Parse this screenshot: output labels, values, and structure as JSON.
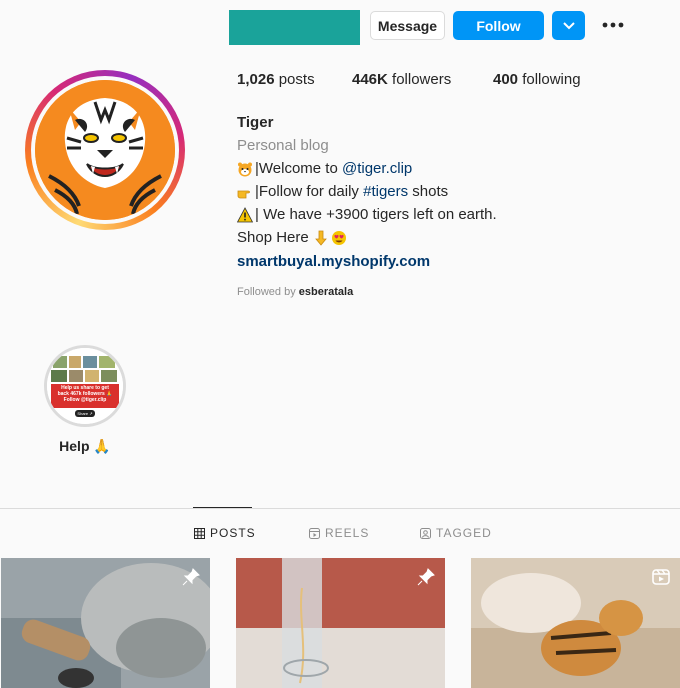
{
  "header": {
    "message_label": "Message",
    "follow_label": "Follow",
    "dropdown_icon": "chevron-down-icon",
    "more_icon": "more-options-icon",
    "username_color": "#1aa39a"
  },
  "stats": {
    "posts_count": "1,026",
    "posts_label": "posts",
    "followers_count": "446K",
    "followers_label": "followers",
    "following_count": "400",
    "following_label": "following"
  },
  "bio": {
    "name": "Tiger",
    "category": "Personal blog",
    "line1_prefix": "|Welcome to ",
    "line1_mention": "@tiger.clip",
    "line2_prefix": "|Follow for daily ",
    "line2_hashtag": "#tigers",
    "line2_suffix": " shots",
    "line3_text": "| We have +3900 tigers left on earth.",
    "line4_text": "Shop Here ",
    "link": "smartbuyal.myshopify.com",
    "followed_by_prefix": "Followed by ",
    "followed_by_user": "esberatala"
  },
  "highlight": {
    "label": "Help 🙏",
    "banner_line1": "Help us share to get",
    "banner_line2": "back 467k followers 🙏",
    "banner_line3": "Follow @tiger.clip",
    "banner_line4": "Share ↗"
  },
  "tabs": [
    {
      "label": "POSTS",
      "icon": "grid-icon",
      "active": true
    },
    {
      "label": "REELS",
      "icon": "reels-icon",
      "active": false
    },
    {
      "label": "TAGGED",
      "icon": "tagged-icon",
      "active": false
    }
  ],
  "posts": [
    {
      "badge": "pin-icon"
    },
    {
      "badge": "pin-icon"
    },
    {
      "badge": "reel-icon"
    }
  ],
  "colors": {
    "accent": "#0095f6",
    "link": "#00376b",
    "muted": "#8e8e8e"
  }
}
